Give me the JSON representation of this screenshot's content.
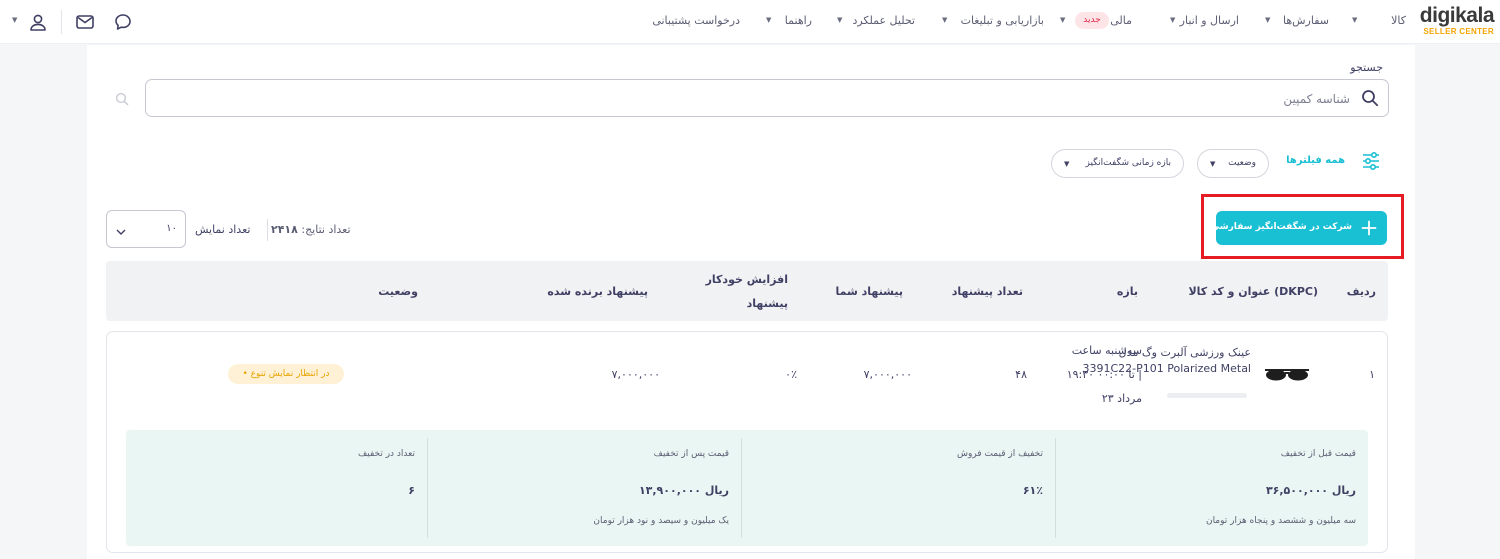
{
  "brand": {
    "name": "digikala",
    "sub": "SELLER CENTER"
  },
  "nav": {
    "items": [
      "کالا",
      "سفارش‌ها",
      "ارسال و انبار",
      "مالی",
      "بازاریابی و تبلیغات",
      "تحلیل عملکرد",
      "راهنما",
      "درخواست پشتیبانی"
    ],
    "new_badge": "جدید"
  },
  "search": {
    "label": "جستجو",
    "placeholder": "شناسه کمپین"
  },
  "filters": {
    "all_label": "همه فیلترها",
    "status_label": "وضعیت",
    "range_label": "بازه زمانی شگفت‌انگیز"
  },
  "toolbar": {
    "add_label": "شرکت در شگفت‌انگیز سفارشی",
    "result_count_label": "تعداد نتایج:",
    "result_count_value": "۲۴۱۸",
    "display_label": "تعداد نمایش",
    "display_value": "۱۰"
  },
  "table": {
    "headers": {
      "row": "ردیف",
      "title": "عنوان و کد کالا (DKPC)",
      "range": "بازه",
      "offer_count": "تعداد پیشنهاد",
      "your_offer": "پیشنهاد شما",
      "auto_increase_1": "افزایش خودکار",
      "auto_increase_2": "پیشنهاد",
      "winning_offer": "پیشنهاد برنده شده",
      "status": "وضعیت"
    },
    "row": {
      "index": "۱",
      "title_1": "عینک ورزشی آلبرت وگ مدل",
      "title_2": "3391C22-P101 Polarized Metal",
      "range_1": "سه‌شنبه ساعت",
      "range_2": "۱۹:۳۰ تا ۰۰:۰۰ |",
      "range_3": "۲۳ مرداد",
      "offer_count": "۴۸",
      "your_offer": "۷,۰۰۰,۰۰۰",
      "auto_increase": "۰٪",
      "winning_offer": "۷,۰۰۰,۰۰۰",
      "status": "• در انتظار نمایش تنوع"
    },
    "details": [
      {
        "title": "قیمت قبل از تخفیف",
        "value": "۳۶,۵۰۰,۰۰۰ ریال",
        "sub": "سه میلیون و ششصد و پنجاه هزار تومان"
      },
      {
        "title": "تخفیف از قیمت فروش",
        "value": "۶۱٪",
        "sub": ""
      },
      {
        "title": "قیمت پس از تخفیف",
        "value": "۱۳,۹۰۰,۰۰۰ ریال",
        "sub": "یک میلیون و سیصد و نود هزار تومان"
      },
      {
        "title": "تعداد در تخفیف",
        "value": "۶",
        "sub": ""
      }
    ]
  },
  "colors": {
    "accent": "#19bfd3",
    "highlight": "#e51c23",
    "brand_sub": "#f5a400"
  }
}
